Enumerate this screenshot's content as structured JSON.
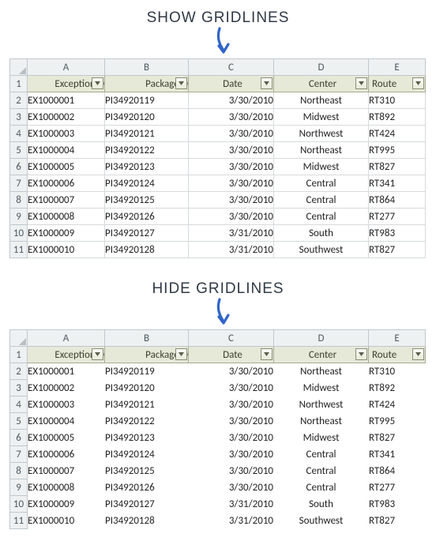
{
  "captions": {
    "show": "SHOW GRIDLINES",
    "hide": "HIDE GRIDLINES"
  },
  "columns": {
    "letters": [
      "A",
      "B",
      "C",
      "D",
      "E"
    ],
    "headers": [
      "ExceptionID",
      "PackageID",
      "Date",
      "Center",
      "Route"
    ]
  },
  "rows": [
    {
      "n": "2",
      "ExceptionID": "EX1000001",
      "PackageID": "PI34920119",
      "Date": "3/30/2010",
      "Center": "Northeast",
      "Route": "RT310"
    },
    {
      "n": "3",
      "ExceptionID": "EX1000002",
      "PackageID": "PI34920120",
      "Date": "3/30/2010",
      "Center": "Midwest",
      "Route": "RT892"
    },
    {
      "n": "4",
      "ExceptionID": "EX1000003",
      "PackageID": "PI34920121",
      "Date": "3/30/2010",
      "Center": "Northwest",
      "Route": "RT424"
    },
    {
      "n": "5",
      "ExceptionID": "EX1000004",
      "PackageID": "PI34920122",
      "Date": "3/30/2010",
      "Center": "Northeast",
      "Route": "RT995"
    },
    {
      "n": "6",
      "ExceptionID": "EX1000005",
      "PackageID": "PI34920123",
      "Date": "3/30/2010",
      "Center": "Midwest",
      "Route": "RT827"
    },
    {
      "n": "7",
      "ExceptionID": "EX1000006",
      "PackageID": "PI34920124",
      "Date": "3/30/2010",
      "Center": "Central",
      "Route": "RT341"
    },
    {
      "n": "8",
      "ExceptionID": "EX1000007",
      "PackageID": "PI34920125",
      "Date": "3/30/2010",
      "Center": "Central",
      "Route": "RT864"
    },
    {
      "n": "9",
      "ExceptionID": "EX1000008",
      "PackageID": "PI34920126",
      "Date": "3/30/2010",
      "Center": "Central",
      "Route": "RT277"
    },
    {
      "n": "10",
      "ExceptionID": "EX1000009",
      "PackageID": "PI34920127",
      "Date": "3/31/2010",
      "Center": "South",
      "Route": "RT983"
    },
    {
      "n": "11",
      "ExceptionID": "EX1000010",
      "PackageID": "PI34920128",
      "Date": "3/31/2010",
      "Center": "Southwest",
      "Route": "RT827"
    }
  ],
  "header_row_num": "1"
}
